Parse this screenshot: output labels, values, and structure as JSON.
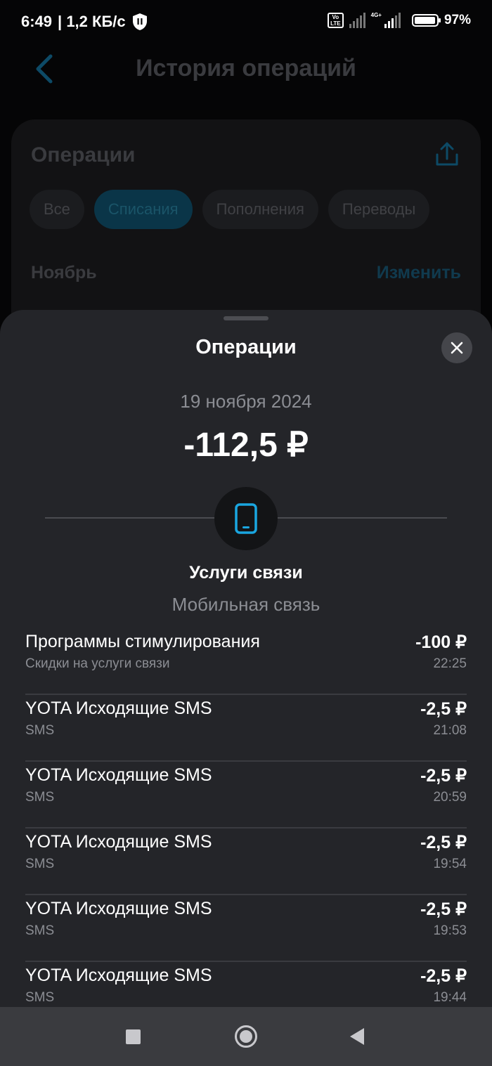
{
  "status_bar": {
    "time": "6:49",
    "network_speed": "| 1,2 КБ/с",
    "volte_label": "Vo\nLTE",
    "network_type": "4G+",
    "battery": "97%"
  },
  "background_page": {
    "title": "История операций",
    "card_title": "Операции",
    "filters": [
      {
        "label": "Все",
        "active": false
      },
      {
        "label": "Списания",
        "active": true
      },
      {
        "label": "Пополнения",
        "active": false
      },
      {
        "label": "Переводы",
        "active": false
      }
    ],
    "month": "Ноябрь",
    "change_label": "Изменить"
  },
  "sheet": {
    "title": "Операции",
    "date": "19 ноября 2024",
    "total": "-112,5 ₽",
    "category": "Услуги связи",
    "subcategory": "Мобильная связь",
    "operations": [
      {
        "name": "Программы стимулирования",
        "sub": "Скидки на услуги связи",
        "amount": "-100 ₽",
        "time": "22:25"
      },
      {
        "name": "YOTA Исходящие SMS",
        "sub": "SMS",
        "amount": "-2,5 ₽",
        "time": "21:08"
      },
      {
        "name": "YOTA Исходящие SMS",
        "sub": "SMS",
        "amount": "-2,5 ₽",
        "time": "20:59"
      },
      {
        "name": "YOTA Исходящие SMS",
        "sub": "SMS",
        "amount": "-2,5 ₽",
        "time": "19:54"
      },
      {
        "name": "YOTA Исходящие SMS",
        "sub": "SMS",
        "amount": "-2,5 ₽",
        "time": "19:53"
      },
      {
        "name": "YOTA Исходящие SMS",
        "sub": "SMS",
        "amount": "-2,5 ₽",
        "time": "19:44"
      }
    ]
  },
  "colors": {
    "accent": "#1aa6e0",
    "sheet_bg": "#242529",
    "secondary_text": "#8b8d93"
  },
  "icons": {
    "back": "chevron-left-icon",
    "share": "share-icon",
    "close": "close-icon",
    "category": "mobile-phone-icon"
  }
}
